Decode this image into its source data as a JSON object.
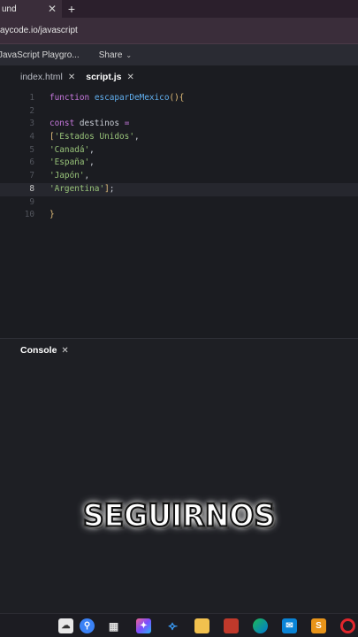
{
  "browser": {
    "tab_title": "und",
    "url": "aycode.io/javascript"
  },
  "playground": {
    "title": "JavaScript Playgro...",
    "share_label": "Share"
  },
  "editor": {
    "tabs": [
      {
        "label": "index.html",
        "active": false
      },
      {
        "label": "script.js",
        "active": true
      }
    ],
    "lines": [
      {
        "n": "1",
        "tokens": [
          {
            "t": "function ",
            "c": "kw"
          },
          {
            "t": "escaparDeMexico",
            "c": "fn"
          },
          {
            "t": "(",
            "c": "br"
          },
          {
            "t": ")",
            "c": "br"
          },
          {
            "t": "{",
            "c": "br"
          }
        ]
      },
      {
        "n": "2",
        "tokens": []
      },
      {
        "n": "3",
        "tokens": [
          {
            "t": "const ",
            "c": "kw"
          },
          {
            "t": "destinos ",
            "c": "pl"
          },
          {
            "t": "=",
            "c": "kw"
          }
        ]
      },
      {
        "n": "4",
        "tokens": [
          {
            "t": "[",
            "c": "br"
          },
          {
            "t": "'Estados Unidos'",
            "c": "str"
          },
          {
            "t": ",",
            "c": "pl"
          }
        ]
      },
      {
        "n": "5",
        "tokens": [
          {
            "t": "'Canadá'",
            "c": "str"
          },
          {
            "t": ",",
            "c": "pl"
          }
        ]
      },
      {
        "n": "6",
        "tokens": [
          {
            "t": "'España'",
            "c": "str"
          },
          {
            "t": ",",
            "c": "pl"
          }
        ]
      },
      {
        "n": "7",
        "tokens": [
          {
            "t": "'Japón'",
            "c": "str"
          },
          {
            "t": ",",
            "c": "pl"
          }
        ]
      },
      {
        "n": "8",
        "tokens": [
          {
            "t": "'Argentina'",
            "c": "str"
          },
          {
            "t": "]",
            "c": "br"
          },
          {
            "t": ";",
            "c": "pl"
          }
        ],
        "active": true
      },
      {
        "n": "9",
        "tokens": []
      },
      {
        "n": "10",
        "tokens": [
          {
            "t": "}",
            "c": "br"
          }
        ]
      }
    ]
  },
  "console": {
    "label": "Console"
  },
  "overlay_text": "SEGUIRNOS",
  "colors": {
    "keyword": "#c678dd",
    "function": "#61afef",
    "string": "#98c379",
    "bracket": "#e5c07b"
  }
}
